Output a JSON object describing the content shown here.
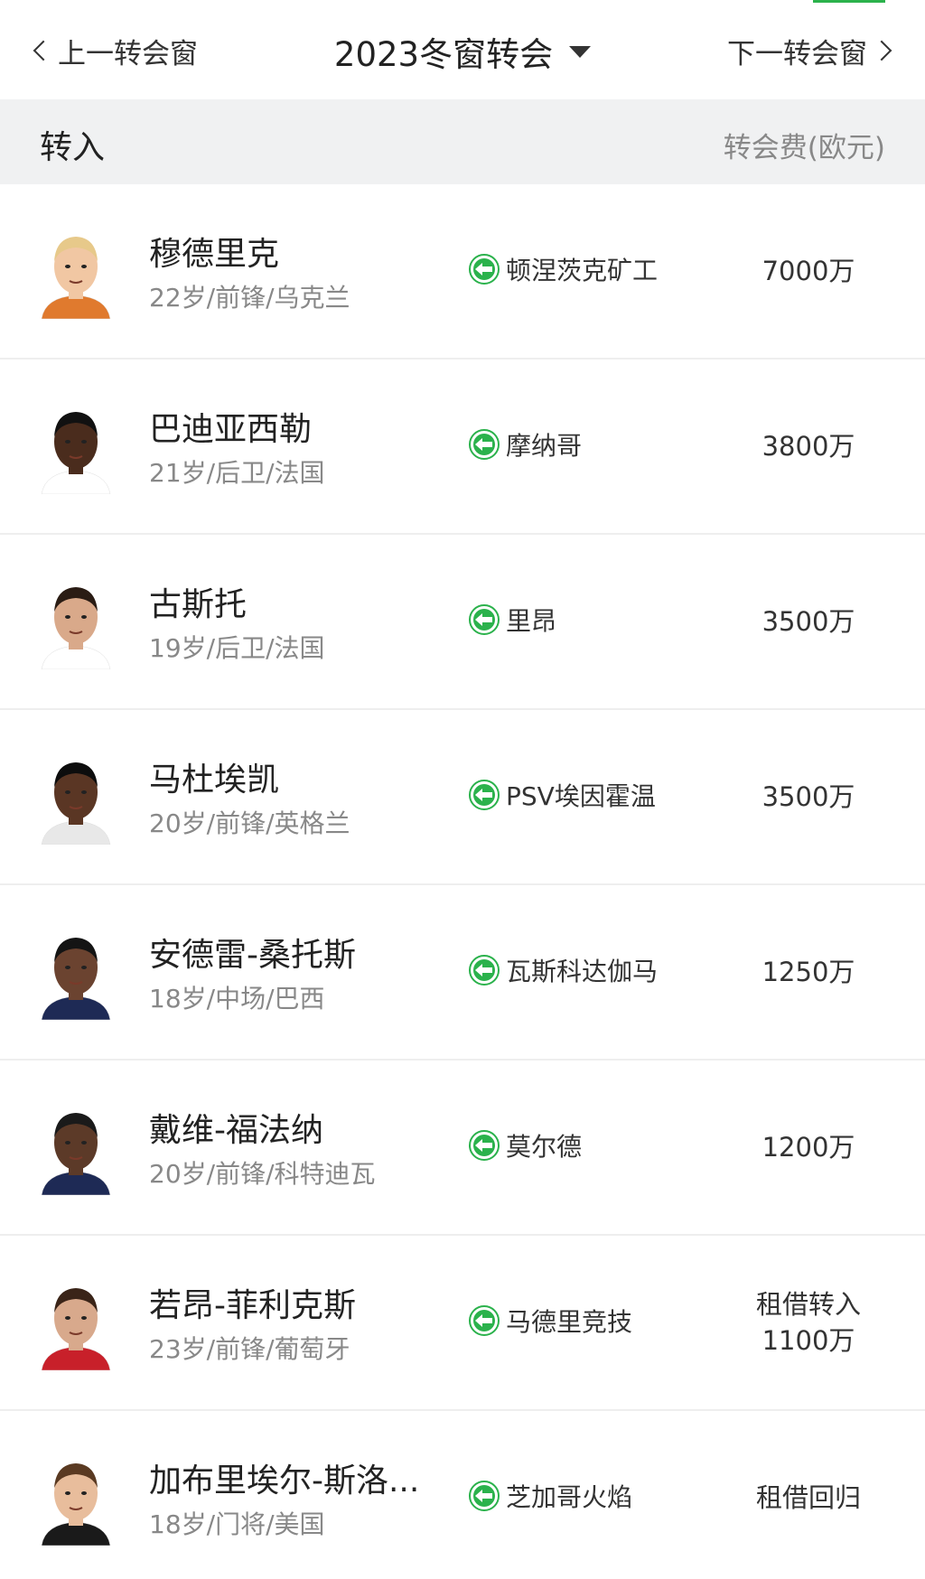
{
  "nav": {
    "prev_label": "上一转会窗",
    "title": "2023冬窗转会",
    "next_label": "下一转会窗"
  },
  "section": {
    "title": "转入",
    "fee_header": "转会费(欧元)"
  },
  "colors": {
    "accent_green": "#2bb24c",
    "header_bg": "#f0f1f2"
  },
  "players": [
    {
      "name": "穆德里克",
      "info": "22岁/前锋/乌克兰",
      "from_club": "顿涅茨克矿工",
      "fee": "7000万",
      "fee_line2": ""
    },
    {
      "name": "巴迪亚西勒",
      "info": "21岁/后卫/法国",
      "from_club": "摩纳哥",
      "fee": "3800万",
      "fee_line2": ""
    },
    {
      "name": "古斯托",
      "info": "19岁/后卫/法国",
      "from_club": "里昂",
      "fee": "3500万",
      "fee_line2": ""
    },
    {
      "name": "马杜埃凯",
      "info": "20岁/前锋/英格兰",
      "from_club": "PSV埃因霍温",
      "fee": "3500万",
      "fee_line2": ""
    },
    {
      "name": "安德雷-桑托斯",
      "info": "18岁/中场/巴西",
      "from_club": "瓦斯科达伽马",
      "fee": "1250万",
      "fee_line2": ""
    },
    {
      "name": "戴维-福法纳",
      "info": "20岁/前锋/科特迪瓦",
      "from_club": "莫尔德",
      "fee": "1200万",
      "fee_line2": ""
    },
    {
      "name": "若昂-菲利克斯",
      "info": "23岁/前锋/葡萄牙",
      "from_club": "马德里竞技",
      "fee": "租借转入",
      "fee_line2": "1100万"
    },
    {
      "name": "加布里埃尔-斯洛...",
      "info": "18岁/门将/美国",
      "from_club": "芝加哥火焰",
      "fee": "租借回归",
      "fee_line2": ""
    }
  ]
}
